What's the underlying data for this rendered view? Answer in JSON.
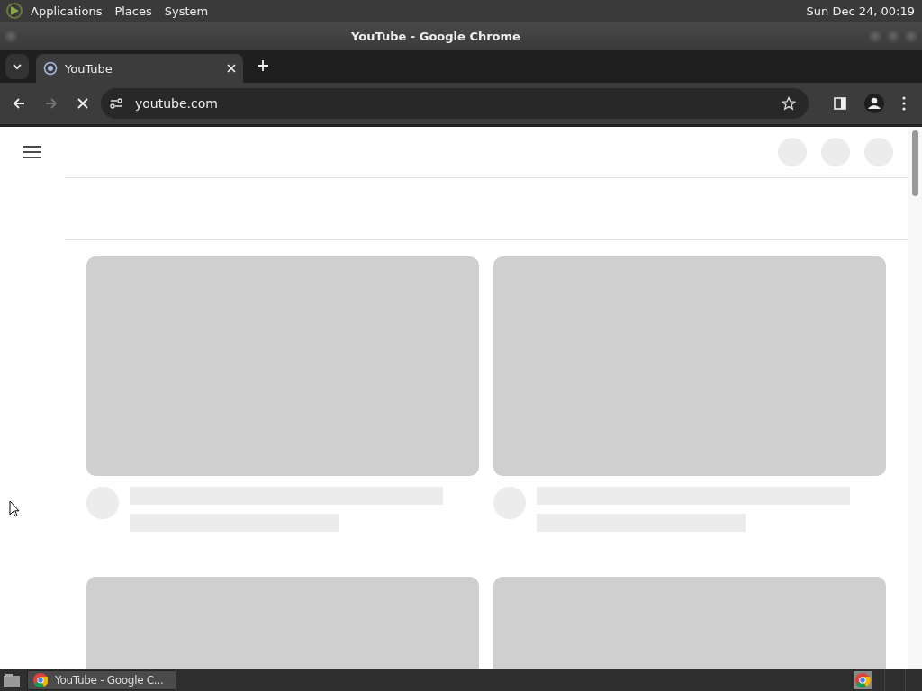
{
  "top_panel": {
    "menus": [
      "Applications",
      "Places",
      "System"
    ],
    "clock": "Sun Dec 24, 00:19"
  },
  "window": {
    "title": "YouTube - Google Chrome"
  },
  "tabs": [
    {
      "label": "YouTube",
      "selected": true
    }
  ],
  "toolbar": {
    "address": "youtube.com",
    "loading": true,
    "forward_disabled": true
  },
  "feed": [
    {
      "kind": "placeholder"
    },
    {
      "kind": "placeholder"
    },
    {
      "kind": "thumbnail_only"
    },
    {
      "kind": "thumbnail_only"
    }
  ],
  "taskbar": {
    "windows": [
      {
        "label": "YouTube - Google C...",
        "selected": true
      }
    ]
  }
}
